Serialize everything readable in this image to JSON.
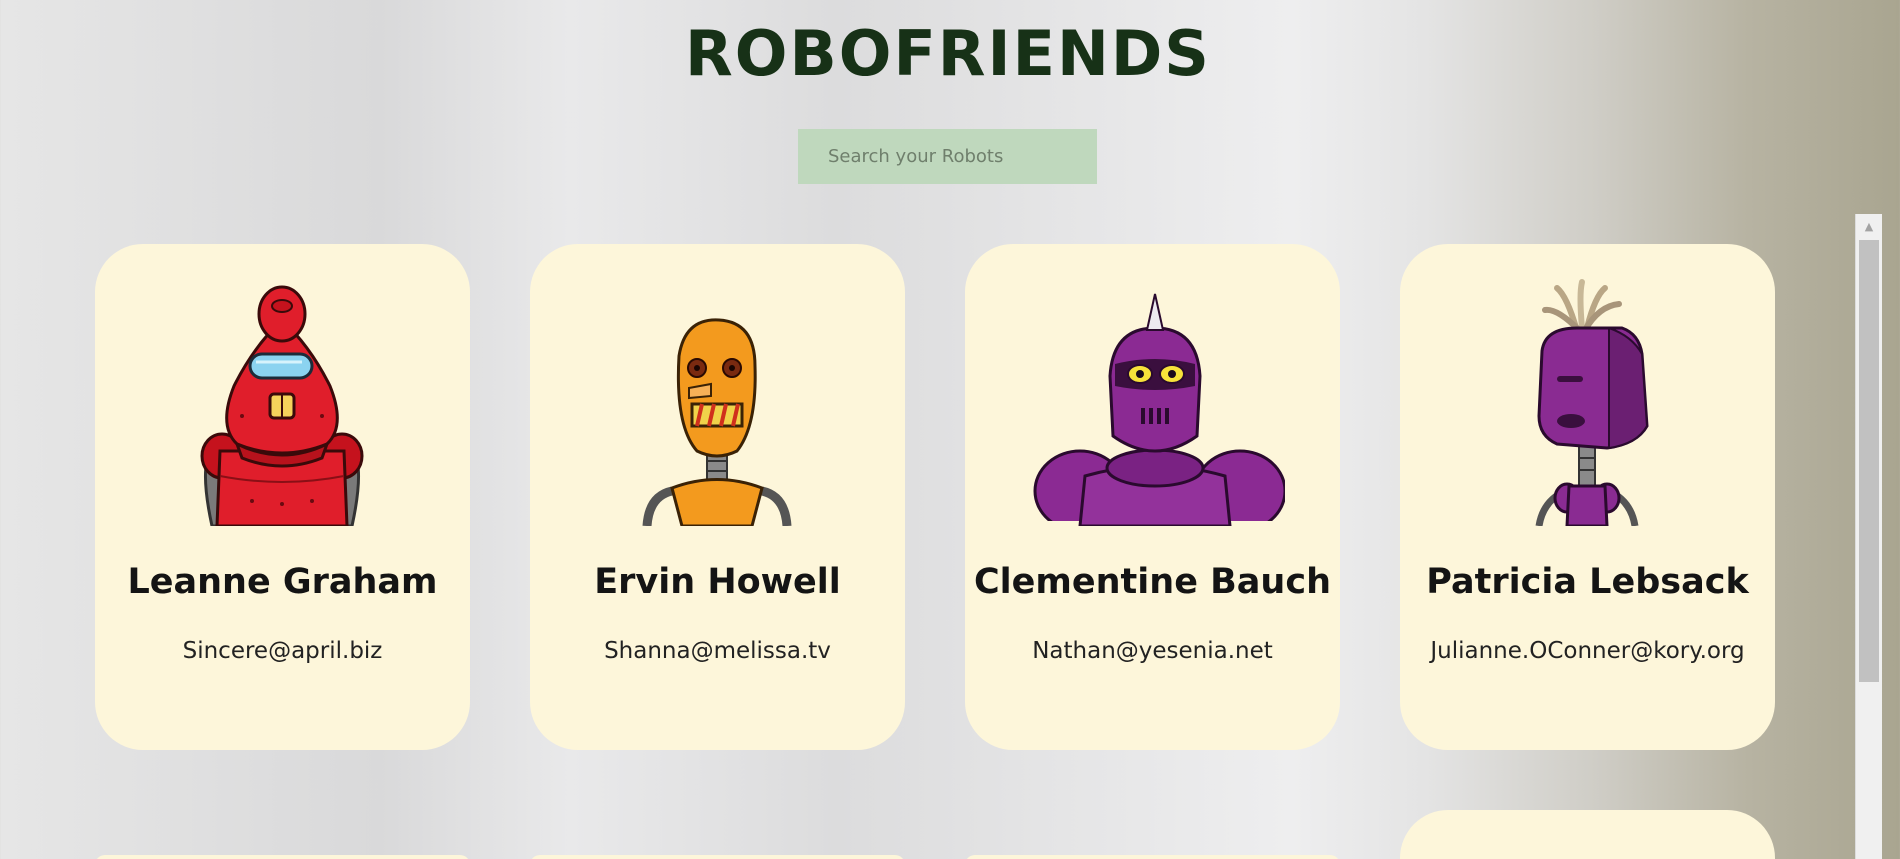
{
  "header": {
    "title": "ROBOFRIENDS"
  },
  "search": {
    "placeholder": "Search your Robots",
    "value": ""
  },
  "robots": [
    {
      "name": "Leanne Graham",
      "email": "Sincere@april.biz",
      "avatar_icon": "red-robot-avatar",
      "color": "#e01e2b"
    },
    {
      "name": "Ervin Howell",
      "email": "Shanna@melissa.tv",
      "avatar_icon": "orange-robot-avatar",
      "color": "#f39a1e"
    },
    {
      "name": "Clementine Bauch",
      "email": "Nathan@yesenia.net",
      "avatar_icon": "purple-robot-avatar",
      "color": "#8b2a93"
    },
    {
      "name": "Patricia Lebsack",
      "email": "Julianne.OConner@kory.org",
      "avatar_icon": "purple-robot-avatar",
      "color": "#8a2b92"
    }
  ],
  "colors": {
    "card_background": "#fdf6da",
    "title": "#173117",
    "search_background": "#bfd8bd"
  }
}
